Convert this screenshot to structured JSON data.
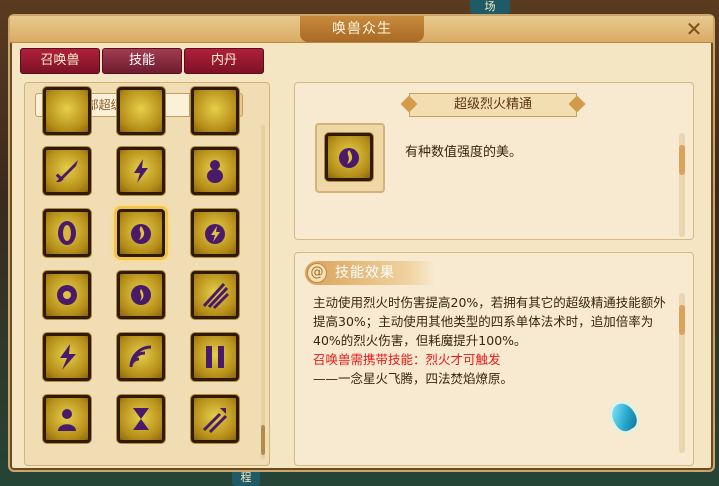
{
  "window": {
    "title": "唤兽众生",
    "close_glyph": "✕"
  },
  "tabs": [
    {
      "label": "召唤兽",
      "active": false
    },
    {
      "label": "技能",
      "active": true
    },
    {
      "label": "内丹",
      "active": false
    }
  ],
  "filter": {
    "selected": "超级(全部超级技...",
    "arrow_glyph": "▼",
    "search_icon": "search-icon"
  },
  "skills": [
    {
      "icon": "glow-icon"
    },
    {
      "icon": "glow-icon"
    },
    {
      "icon": "glow-icon"
    },
    {
      "icon": "sword-icon"
    },
    {
      "icon": "lightning-icon"
    },
    {
      "icon": "gourd-icon"
    },
    {
      "icon": "shield-icon"
    },
    {
      "icon": "fire-swirl-icon",
      "selected": true
    },
    {
      "icon": "lightning-swirl-icon"
    },
    {
      "icon": "flame-icon"
    },
    {
      "icon": "flame-icon"
    },
    {
      "icon": "claw-icon"
    },
    {
      "icon": "split-bolt-icon"
    },
    {
      "icon": "wave-icon"
    },
    {
      "icon": "gate-icon"
    },
    {
      "icon": "person-icon"
    },
    {
      "icon": "hourglass-icon"
    },
    {
      "icon": "arrows-icon"
    }
  ],
  "detail": {
    "name": "超级烈火精通",
    "description": "有种数值强度的美。",
    "icon": "fire-swirl-icon"
  },
  "effect": {
    "heading": "技能效果",
    "paragraph": "主动使用烈火时伤害提高20%，若拥有其它的超级精通技能额外提高30%；主动使用其他类型的四系单体法术时，追加倍率为40%的烈火伤害，但耗魔提升100%。",
    "requirement": "召唤兽需携带技能：烈火才可触发",
    "flavor": "——一念星火飞腾，四法焚焰燎原。"
  },
  "background": {
    "sign_top": "场",
    "sign_bottom": "程"
  },
  "colors": {
    "tab_red": "#7d1226",
    "panel": "#f4e6c3",
    "highlight": "#f3c44a",
    "requirement_red": "#e41c1c"
  }
}
